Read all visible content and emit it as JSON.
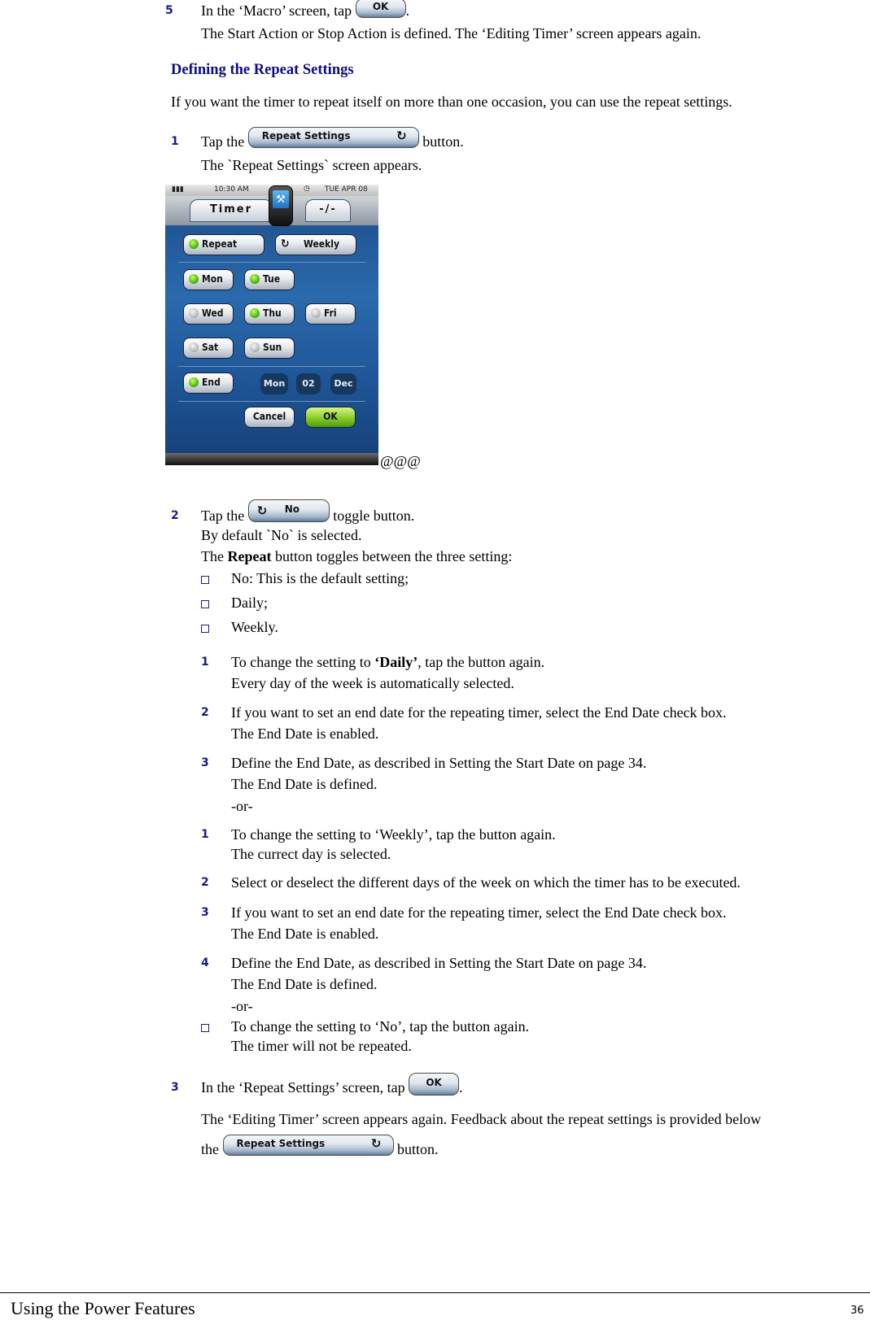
{
  "step5": {
    "number": "5",
    "line1_pre": "In the ‘Macro’ screen, tap",
    "ok_button": "OK",
    "line1_post": ".",
    "line2": "The Start Action or Stop Action is defined. The ‘Editing Timer’ screen appears again."
  },
  "section": {
    "heading": "Defining the Repeat Settings",
    "intro": "If you want the timer to repeat itself on more than one occasion, you can use the repeat settings."
  },
  "step1": {
    "number": "1",
    "pre": "Tap the",
    "button_label": "Repeat Settings",
    "button_icon": "cycle-arrows-icon",
    "post": "button.",
    "result": "The `Repeat Settings` screen appears."
  },
  "device_screen": {
    "status": {
      "battery_icon": "battery-icon",
      "time": "10:30 AM",
      "clock_icon": "clock-icon",
      "date": "TUE APR 08"
    },
    "tabs": {
      "left": "Timer",
      "right": "-/-"
    },
    "repeat_row": {
      "repeat_label": "Repeat",
      "repeat_checked": true,
      "mode_label": "Weekly",
      "mode_icon": "cycle-arrows-icon"
    },
    "days": [
      {
        "label": "Mon",
        "checked": true
      },
      {
        "label": "Tue",
        "checked": true
      },
      {
        "label": "Wed",
        "checked": false
      },
      {
        "label": "Thu",
        "checked": true
      },
      {
        "label": "Fri",
        "checked": false
      },
      {
        "label": "Sat",
        "checked": false
      },
      {
        "label": "Sun",
        "checked": false
      }
    ],
    "end": {
      "label": "End",
      "checked": true,
      "weekday": "Mon",
      "day": "02",
      "month": "Dec"
    },
    "cancel_label": "Cancel",
    "ok_label": "OK"
  },
  "figure_suffix": "@@@",
  "step2": {
    "number": "2",
    "pre": "Tap the",
    "button_label": "No",
    "post": "toggle button.",
    "line2": "By default `No` is selected.",
    "line3_pre": "The ",
    "line3_bold": "Repeat",
    "line3_post": " button toggles between the three setting:",
    "options": [
      "No: This is the default setting;",
      "Daily;",
      "Weekly."
    ]
  },
  "daily_steps": [
    {
      "number": "1",
      "line1_pre": "To change the setting to ",
      "line1_bold": "‘Daily’",
      "line1_post": ", tap the button again.",
      "line2": "Every day of the week is automatically selected."
    },
    {
      "number": "2",
      "line1": "If you want to set an end date for the repeating timer, select the End Date check box.",
      "line2": "The End Date is enabled."
    },
    {
      "number": "3",
      "line1": "Define the End Date, as described in Setting the Start Date on page 34.",
      "line2": "The End Date is defined.",
      "line3": "-or-"
    }
  ],
  "weekly_steps": [
    {
      "number": "1",
      "line1": "To change the setting to ‘Weekly’, tap the button again.",
      "line2": "The currect day is selected."
    },
    {
      "number": "2",
      "line1": "Select or deselect the different days of the week on which the timer has to be executed."
    },
    {
      "number": "3",
      "line1": "If you want to set an end date for the repeating timer, select the End Date check box.",
      "line2": "The End Date is enabled."
    },
    {
      "number": "4",
      "line1": "Define the End Date, as described in Setting the Start Date on page 34.",
      "line2": "The End Date is defined.",
      "line3": "-or-"
    }
  ],
  "no_option": {
    "line1": "To change the setting to ‘No’, tap the button again.",
    "line2": "The timer will not be repeated."
  },
  "step3": {
    "number": "3",
    "pre": "In the ‘Repeat Settings’ screen, tap",
    "ok_button": "OK",
    "post": ".",
    "line2": "The ‘Editing Timer’ screen appears again. Feedback about the repeat settings is provided below",
    "line3_pre": "the",
    "button_label": "Repeat Settings",
    "line3_post": "button."
  },
  "footer": {
    "title": "Using the Power Features",
    "page": "36"
  }
}
